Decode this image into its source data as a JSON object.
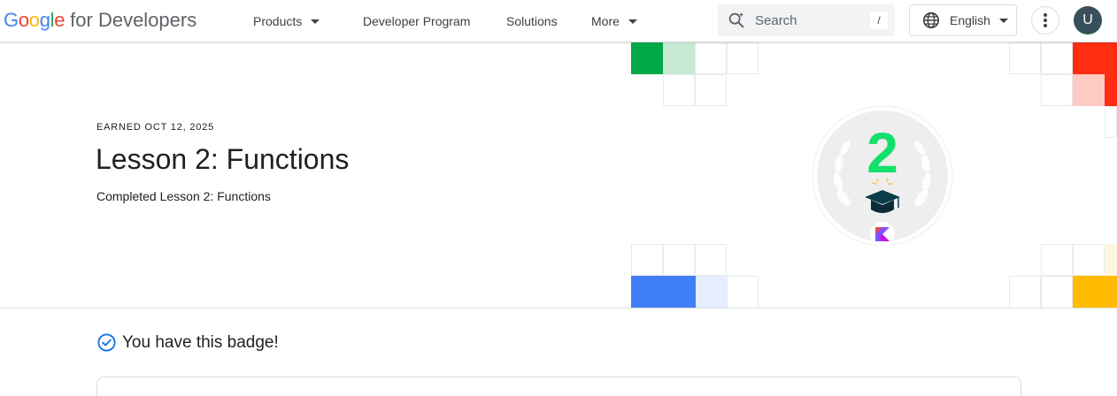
{
  "header": {
    "logo_letters": [
      "G",
      "o",
      "o",
      "g",
      "l",
      "e"
    ],
    "logo_suffix": "for Developers",
    "nav": [
      {
        "label": "Products",
        "dropdown": true
      },
      {
        "label": "Developer Program",
        "dropdown": false
      },
      {
        "label": "Solutions",
        "dropdown": false
      },
      {
        "label": "More",
        "dropdown": true
      }
    ],
    "search_placeholder": "Search",
    "search_shortcut": "/",
    "language": "English",
    "avatar_initial": "U",
    "icons": [
      "search-sparkle-icon",
      "globe-icon",
      "more-vert-icon"
    ]
  },
  "badge_page": {
    "earned": "EARNED OCT 12, 2025",
    "title": "Lesson 2: Functions",
    "subtitle": "Completed Lesson 2: Functions",
    "badge_number": "2",
    "badge_icons": [
      "graduation-cap-icon",
      "kotlin-logo-icon"
    ]
  },
  "status": {
    "text": "You have this badge!",
    "icon": "check-circle-icon"
  },
  "colors": {
    "green": "#00a847",
    "light_green": "#c8ead4",
    "red": "#ff2d12",
    "light_red": "#ffc9c4",
    "blue": "#3f7ef6",
    "light_blue": "#e4eefe",
    "yellow": "#ffbb00",
    "light_yellow": "#fff7e0",
    "badge_number": "#12e06a",
    "check": "#1a73e8"
  }
}
